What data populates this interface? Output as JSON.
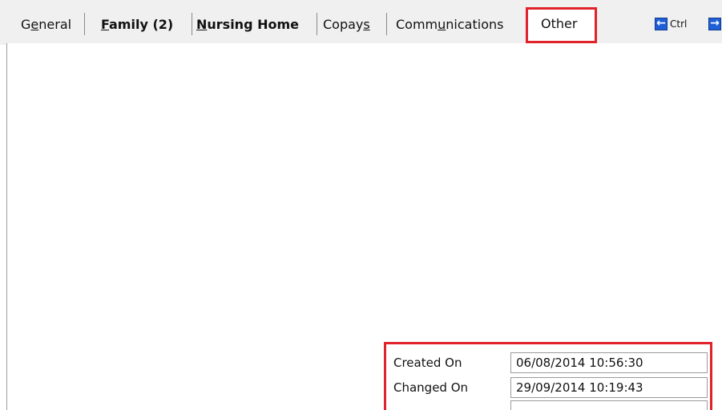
{
  "tabs": [
    {
      "pre": "G",
      "mnemonic": "e",
      "post": "neral",
      "bold": false
    },
    {
      "pre": "",
      "mnemonic": "F",
      "post": "amily (2)",
      "bold": true
    },
    {
      "pre": "",
      "mnemonic": "N",
      "post": "ursing Home",
      "bold": true
    },
    {
      "pre": "Copay",
      "mnemonic": "s",
      "post": "",
      "bold": false
    },
    {
      "pre": "Comm",
      "mnemonic": "u",
      "post": "nications",
      "bold": false
    },
    {
      "pre": "Other",
      "mnemonic": "",
      "post": "",
      "bold": false,
      "active": true
    }
  ],
  "nav": {
    "ctrl_label": "Ctrl",
    "prev_icon": "arrow-left-icon",
    "next_icon": "arrow-right-icon"
  },
  "info": {
    "created_label": "Created On",
    "created_value": "06/08/2014 10:56:30",
    "changed_label": "Changed On",
    "changed_value": "29/09/2014 10:19:43"
  },
  "colors": {
    "highlight": "#e0222b",
    "nav_arrow": "#1e5fd8",
    "tab_strip": "#f0f0f0"
  }
}
